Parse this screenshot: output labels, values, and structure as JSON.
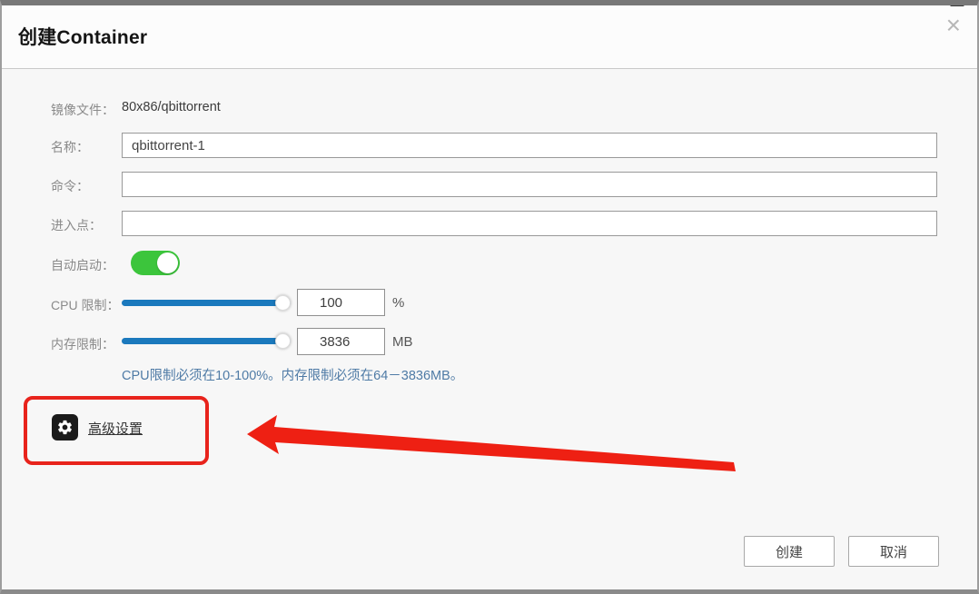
{
  "window": {
    "title": "创建Container",
    "close_icon": "×"
  },
  "form": {
    "image_label": "镜像文件：",
    "image_value": "80x86/qbittorrent",
    "name_label": "名称：",
    "name_value": "qbittorrent-1",
    "command_label": "命令：",
    "command_value": "",
    "entrypoint_label": "进入点：",
    "entrypoint_value": "",
    "autostart_label": "自动启动：",
    "autostart_state": "on",
    "cpu_label": "CPU 限制：",
    "cpu_value": "100",
    "cpu_unit": "%",
    "cpu_slider_percent": 100,
    "memory_label": "内存限制：",
    "memory_value": "3836",
    "memory_unit": "MB",
    "memory_slider_percent": 100,
    "hint": "CPU限制必须在10-100%。内存限制必须在64－3836MB。"
  },
  "advanced": {
    "label": "高级设置",
    "icon": "gear-icon"
  },
  "buttons": {
    "create": "创建",
    "cancel": "取消"
  },
  "colors": {
    "slider_blue": "#1b79bd",
    "toggle_green": "#3cc53c",
    "hint_blue": "#4f7ba6",
    "highlight_red": "#e8231c",
    "dialog_background": "#f7f7f7"
  }
}
